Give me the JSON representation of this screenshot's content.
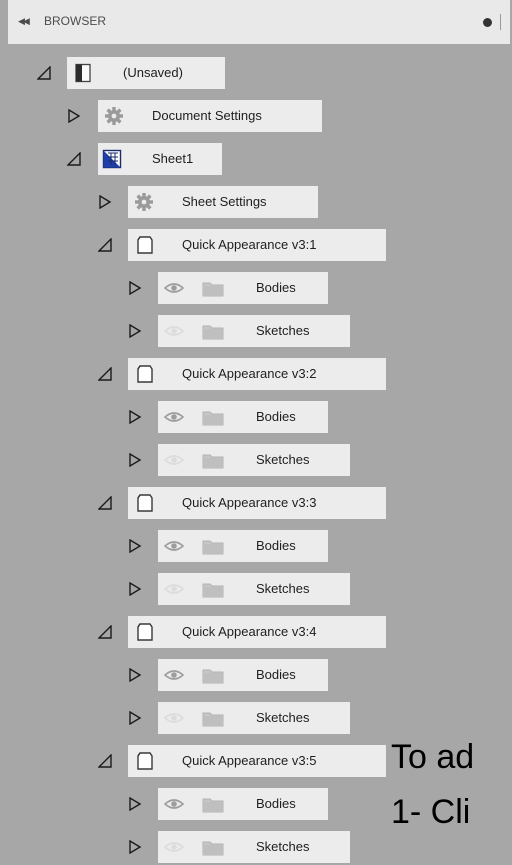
{
  "browser": {
    "title": "BROWSER",
    "collapse_icon": "double-left-arrow-icon",
    "root": "(Unsaved)",
    "document_settings": "Document Settings",
    "sheet": "Sheet1",
    "sheet_settings": "Sheet Settings",
    "components": [
      {
        "name": "Quick Appearance v3:1",
        "children": [
          "Bodies",
          "Sketches"
        ]
      },
      {
        "name": "Quick Appearance v3:2",
        "children": [
          "Bodies",
          "Sketches"
        ]
      },
      {
        "name": "Quick Appearance v3:3",
        "children": [
          "Bodies",
          "Sketches"
        ]
      },
      {
        "name": "Quick Appearance v3:4",
        "children": [
          "Bodies",
          "Sketches"
        ]
      },
      {
        "name": "Quick Appearance v3:5",
        "children": [
          "Bodies",
          "Sketches"
        ]
      }
    ]
  },
  "overlay": {
    "line1": "To ad",
    "line2": "1- Cli"
  }
}
